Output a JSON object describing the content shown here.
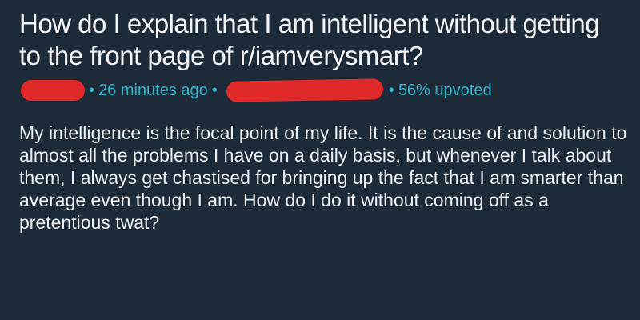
{
  "post": {
    "title": "How do I explain that I am intelligent without getting to the front page of r/iamverysmart?",
    "time_ago": "26 minutes ago",
    "upvote_ratio": "56% upvoted",
    "body": "My intelligence is the focal point of my life. It is the cause of and solution to almost all the problems I have on a daily basis, but whenever I talk about them, I always get chastised for bringing up the fact that I am smarter than average even though I am. How do I do it without coming off as a pretentious twat?"
  },
  "colors": {
    "background": "#1d2a37",
    "text": "#eef1f4",
    "meta_accent": "#29b6cf",
    "redaction": "#e02929"
  }
}
